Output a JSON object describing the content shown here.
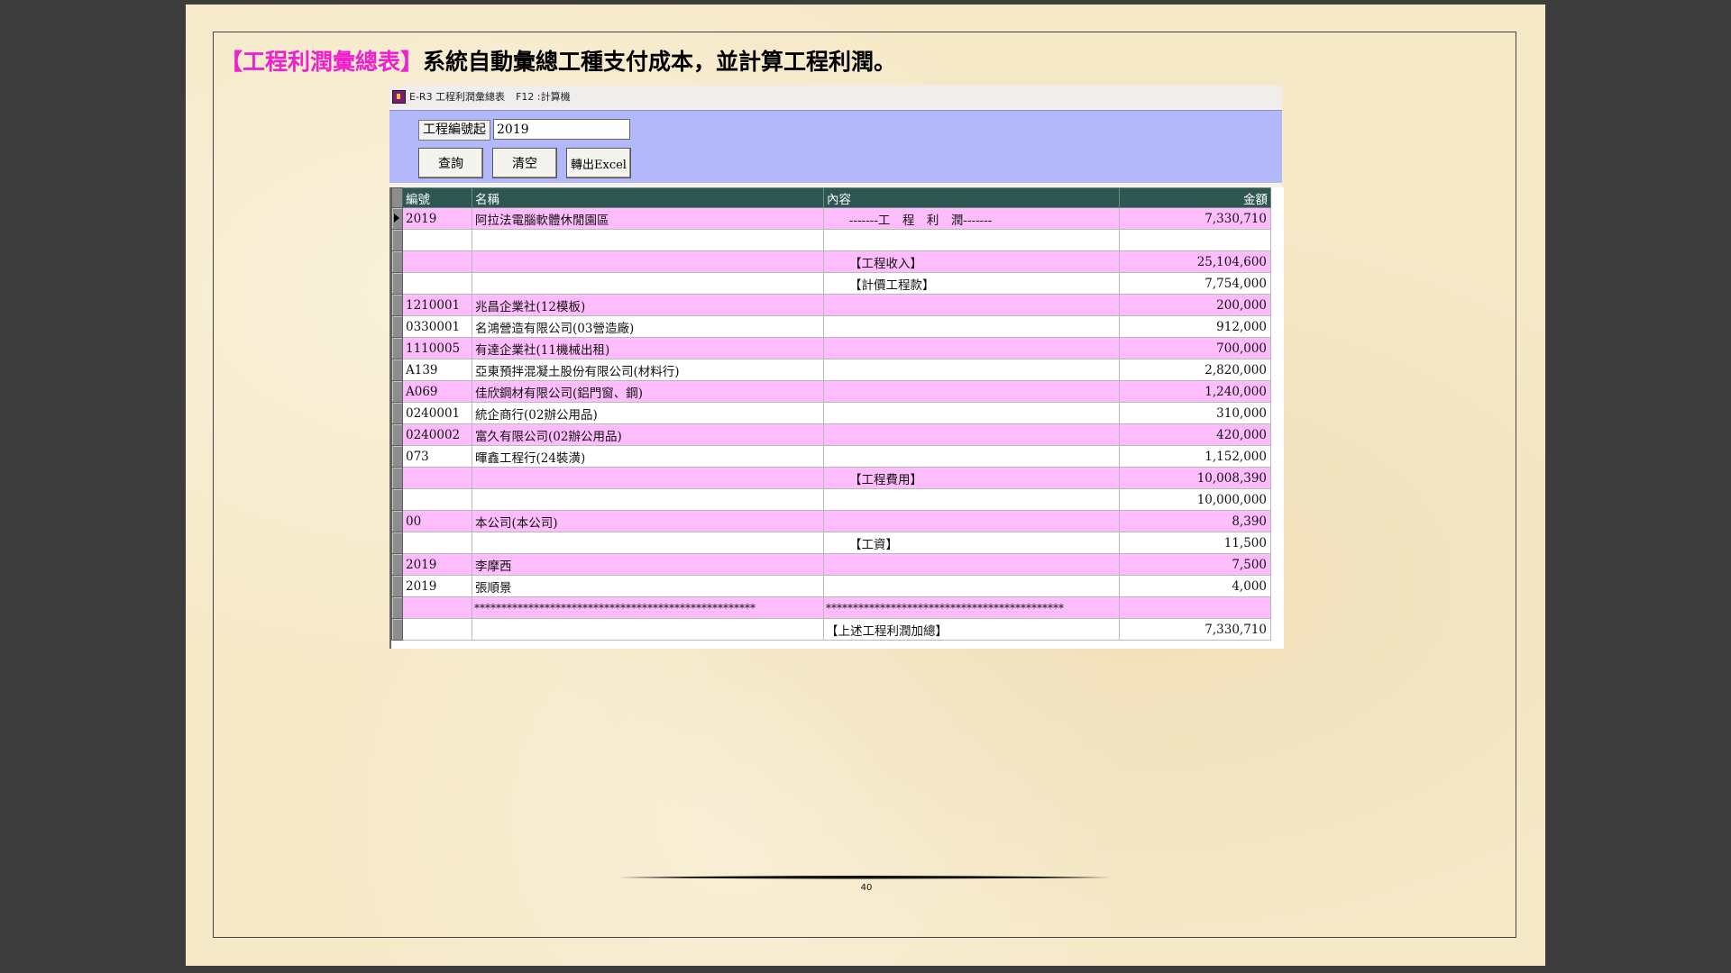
{
  "document": {
    "heading_highlight": "【工程利潤彙總表】",
    "heading_text": "系統自動彙總工種支付成本，並計算工程利潤。",
    "page_number": "40"
  },
  "window": {
    "title": "E-R3 工程利潤彙總表",
    "hotkey": "F12 :計算機"
  },
  "toolbar": {
    "start_label": "工程編號起",
    "start_value": "2019",
    "query_label": "查詢",
    "clear_label": "清空",
    "excel_label": "轉出Excel"
  },
  "grid": {
    "columns": [
      "編號",
      "名稱",
      "內容",
      "金額"
    ],
    "rows": [
      {
        "code": "2019",
        "name": "阿拉法電腦軟體休閒園區",
        "content": "-------工　程　利　潤-------",
        "amount": "7,330,710"
      },
      {
        "code": "",
        "name": "",
        "content": "",
        "amount": ""
      },
      {
        "code": "",
        "name": "",
        "content": "【工程收入】",
        "amount": "25,104,600"
      },
      {
        "code": "",
        "name": "",
        "content": "【計價工程款】",
        "amount": "7,754,000"
      },
      {
        "code": "1210001",
        "name": "兆昌企業社(12模板)",
        "content": "",
        "amount": "200,000"
      },
      {
        "code": "0330001",
        "name": "名鴻營造有限公司(03營造廠)",
        "content": "",
        "amount": "912,000"
      },
      {
        "code": "1110005",
        "name": "有達企業社(11機械出租)",
        "content": "",
        "amount": "700,000"
      },
      {
        "code": "A139",
        "name": "亞東預拌混凝土股份有限公司(材料行)",
        "content": "",
        "amount": "2,820,000"
      },
      {
        "code": "A069",
        "name": "佳欣鋼材有限公司(鋁門窗、鋼)",
        "content": "",
        "amount": "1,240,000"
      },
      {
        "code": "0240001",
        "name": "統企商行(02辦公用品)",
        "content": "",
        "amount": "310,000"
      },
      {
        "code": "0240002",
        "name": "富久有限公司(02辦公用品)",
        "content": "",
        "amount": "420,000"
      },
      {
        "code": "073",
        "name": "暉鑫工程行(24裝潢)",
        "content": "",
        "amount": "1,152,000"
      },
      {
        "code": "",
        "name": "",
        "content": "【工程費用】",
        "amount": "10,008,390"
      },
      {
        "code": "",
        "name": "",
        "content": "",
        "amount": "10,000,000"
      },
      {
        "code": "00",
        "name": "本公司(本公司)",
        "content": "",
        "amount": "8,390"
      },
      {
        "code": "",
        "name": "",
        "content": "【工資】",
        "amount": "11,500"
      },
      {
        "code": "2019",
        "name": "李摩西",
        "content": "",
        "amount": "7,500"
      },
      {
        "code": "2019",
        "name": "張順景",
        "content": "",
        "amount": "4,000"
      },
      {
        "code": "",
        "name": "****************************************************",
        "content": "********************************************",
        "amount": ""
      },
      {
        "code": "",
        "name": "",
        "content": "【上述工程利潤加總】",
        "amount": "7,330,710"
      }
    ]
  }
}
